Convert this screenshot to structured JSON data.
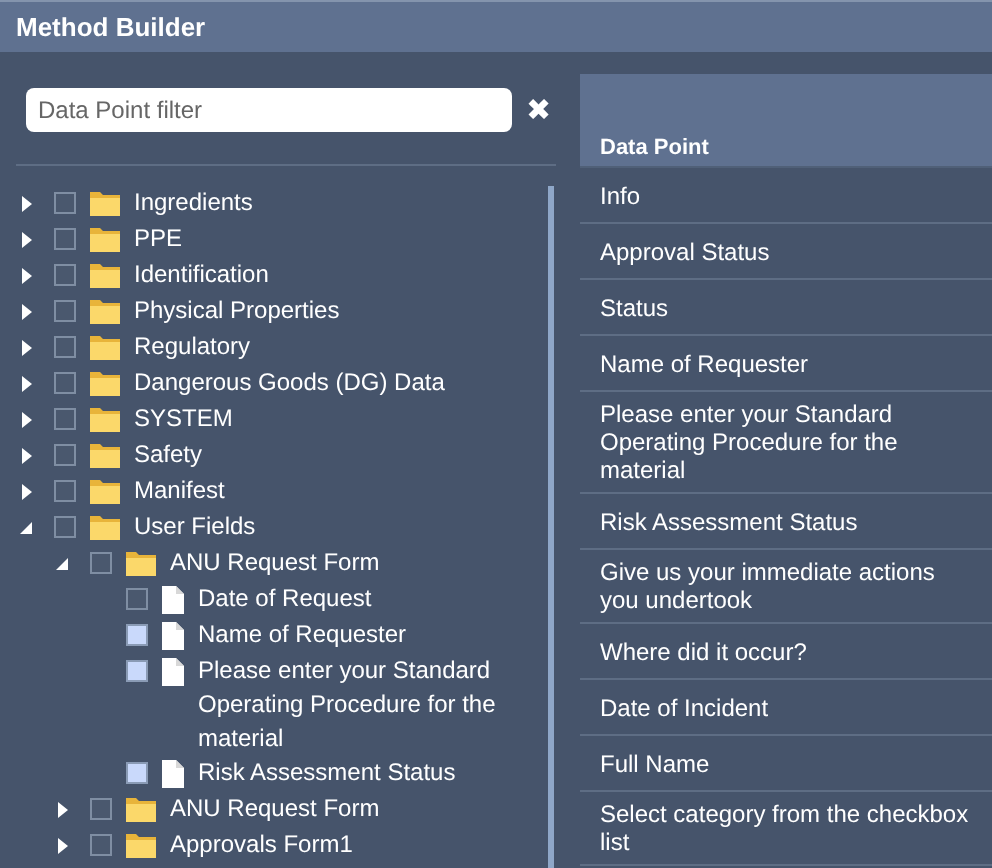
{
  "window": {
    "title": "Method Builder"
  },
  "filter": {
    "placeholder": "Data Point filter",
    "clear": "✖"
  },
  "tree": [
    {
      "label": "Ingredients",
      "kind": "folder",
      "checked": false,
      "expanded": false
    },
    {
      "label": "PPE",
      "kind": "folder",
      "checked": false,
      "expanded": false
    },
    {
      "label": "Identification",
      "kind": "folder",
      "checked": false,
      "expanded": false
    },
    {
      "label": "Physical Properties",
      "kind": "folder",
      "checked": false,
      "expanded": false
    },
    {
      "label": "Regulatory",
      "kind": "folder",
      "checked": false,
      "expanded": false
    },
    {
      "label": "Dangerous Goods (DG) Data",
      "kind": "folder",
      "checked": false,
      "expanded": false
    },
    {
      "label": "SYSTEM",
      "kind": "folder",
      "checked": false,
      "expanded": false
    },
    {
      "label": "Safety",
      "kind": "folder",
      "checked": false,
      "expanded": false
    },
    {
      "label": "Manifest",
      "kind": "folder",
      "checked": false,
      "expanded": false
    },
    {
      "label": "User Fields",
      "kind": "folder",
      "checked": false,
      "expanded": true,
      "children": [
        {
          "label": "ANU Request Form",
          "kind": "folder",
          "checked": false,
          "expanded": true,
          "children": [
            {
              "label": "Date of Request",
              "kind": "file",
              "checked": false
            },
            {
              "label": "Name of Requester",
              "kind": "file",
              "checked": true
            },
            {
              "label": "Please enter your Standard Operating Procedure for the material",
              "kind": "file",
              "checked": true
            },
            {
              "label": "Risk Assessment Status",
              "kind": "file",
              "checked": true
            }
          ]
        },
        {
          "label": "ANU Request Form",
          "kind": "folder",
          "checked": false,
          "expanded": false
        },
        {
          "label": "Approvals Form1",
          "kind": "folder",
          "checked": false,
          "expanded": false
        }
      ]
    }
  ],
  "table": {
    "columns": [
      "Data Point"
    ],
    "rows": [
      "Info",
      "Approval Status",
      "Status",
      "Name of Requester",
      "Please enter your Standard Operating Procedure for the material",
      "Risk Assessment Status",
      "Give us your immediate actions you undertook",
      "Where did it occur?",
      "Date of Incident",
      "Full Name",
      "Select category from the checkbox list"
    ]
  }
}
